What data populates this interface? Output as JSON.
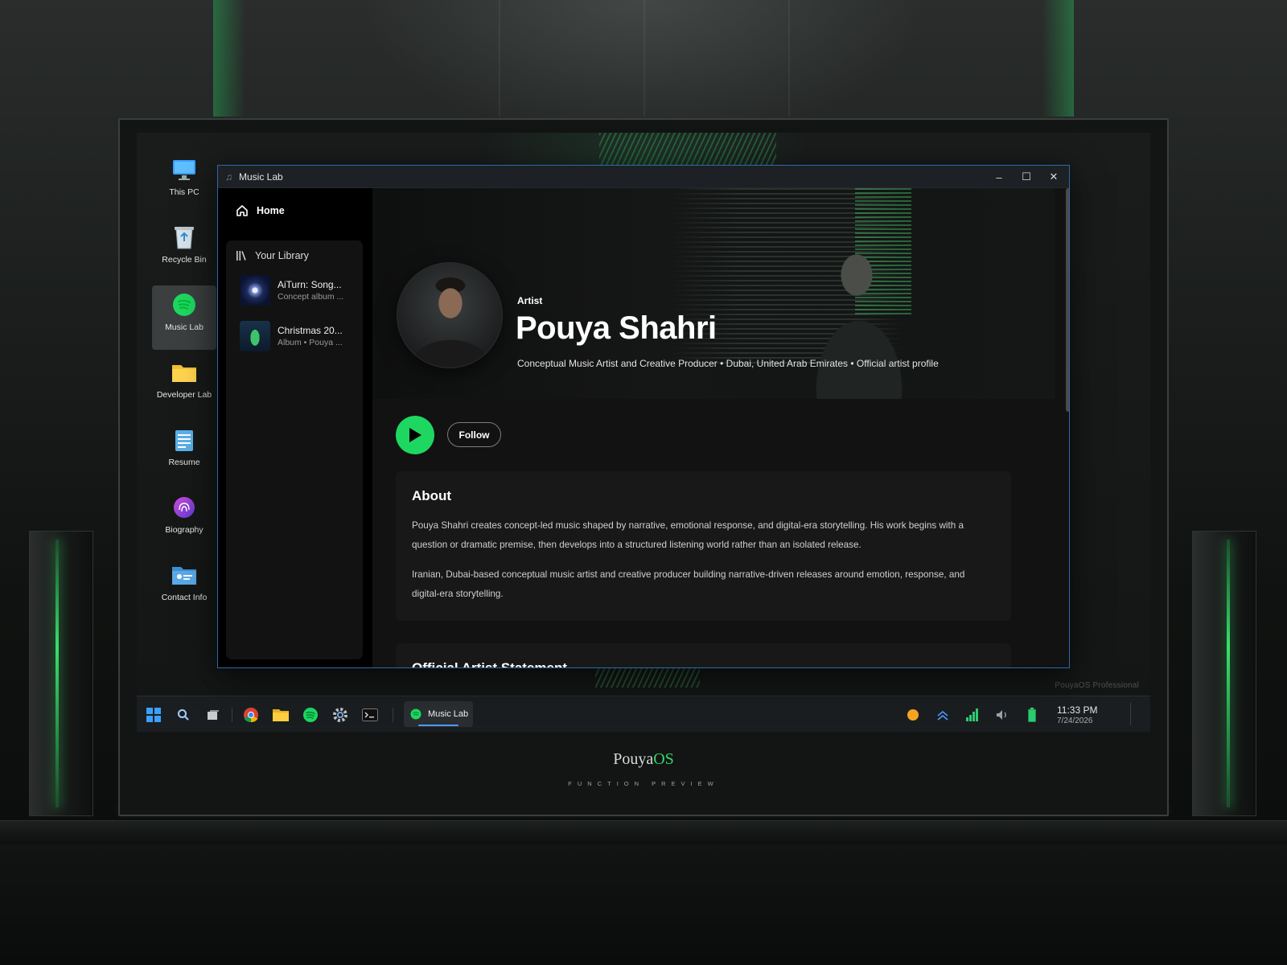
{
  "colors": {
    "accent_green": "#1ed760",
    "window_border": "#2e6aa8",
    "taskbar_indicator": "#4d9cff"
  },
  "desktop": {
    "icons": [
      {
        "label": "This PC",
        "icon": "monitor-icon"
      },
      {
        "label": "Recycle Bin",
        "icon": "recycle-bin-icon"
      },
      {
        "label": "Music Lab",
        "icon": "music-lab-icon"
      },
      {
        "label": "Developer Lab",
        "icon": "folder-icon"
      },
      {
        "label": "Resume",
        "icon": "notepad-icon"
      },
      {
        "label": "Biography",
        "icon": "fingerprint-icon"
      },
      {
        "label": "Contact Info",
        "icon": "contact-card-icon"
      }
    ],
    "watermark": "PouyaOS Professional"
  },
  "window": {
    "title": "Music Lab",
    "controls": {
      "minimize": "–",
      "maximize": "☐",
      "close": "✕"
    }
  },
  "sidebar": {
    "home_label": "Home",
    "library_label": "Your Library",
    "library_items": [
      {
        "title": "AiTurn: Song...",
        "subtitle": "Concept album ..."
      },
      {
        "title": "Christmas 20...",
        "subtitle": "Album • Pouya ..."
      }
    ]
  },
  "artist": {
    "kicker": "Artist",
    "name": "Pouya Shahri",
    "subtitle": "Conceptual Music Artist and Creative Producer • Dubai, United Arab Emirates • Official artist profile",
    "follow_label": "Follow"
  },
  "about": {
    "title": "About",
    "paragraphs": [
      "Pouya Shahri creates concept-led music shaped by narrative, emotional response, and digital-era storytelling. His work begins with a question or dramatic premise, then develops into a structured listening world rather than an isolated release.",
      "Iranian, Dubai-based conceptual music artist and creative producer building narrative-driven releases around emotion, response, and digital-era storytelling."
    ]
  },
  "statement": {
    "title": "Official Artist Statement"
  },
  "taskbar": {
    "pinned": [
      "start-icon",
      "search-icon",
      "task-view-icon",
      "chrome-icon",
      "file-explorer-icon",
      "music-lab-icon",
      "settings-icon",
      "terminal-icon"
    ],
    "active_app_label": "Music Lab",
    "tray": [
      "theme-toggle-icon",
      "network-up-icon",
      "signal-icon",
      "volume-icon",
      "battery-icon"
    ],
    "time": "11:33 PM",
    "date": "7/24/2026"
  },
  "brand": {
    "name_part1": "Pouya",
    "name_part2": "OS",
    "tagline": "FUNCTION PREVIEW"
  }
}
